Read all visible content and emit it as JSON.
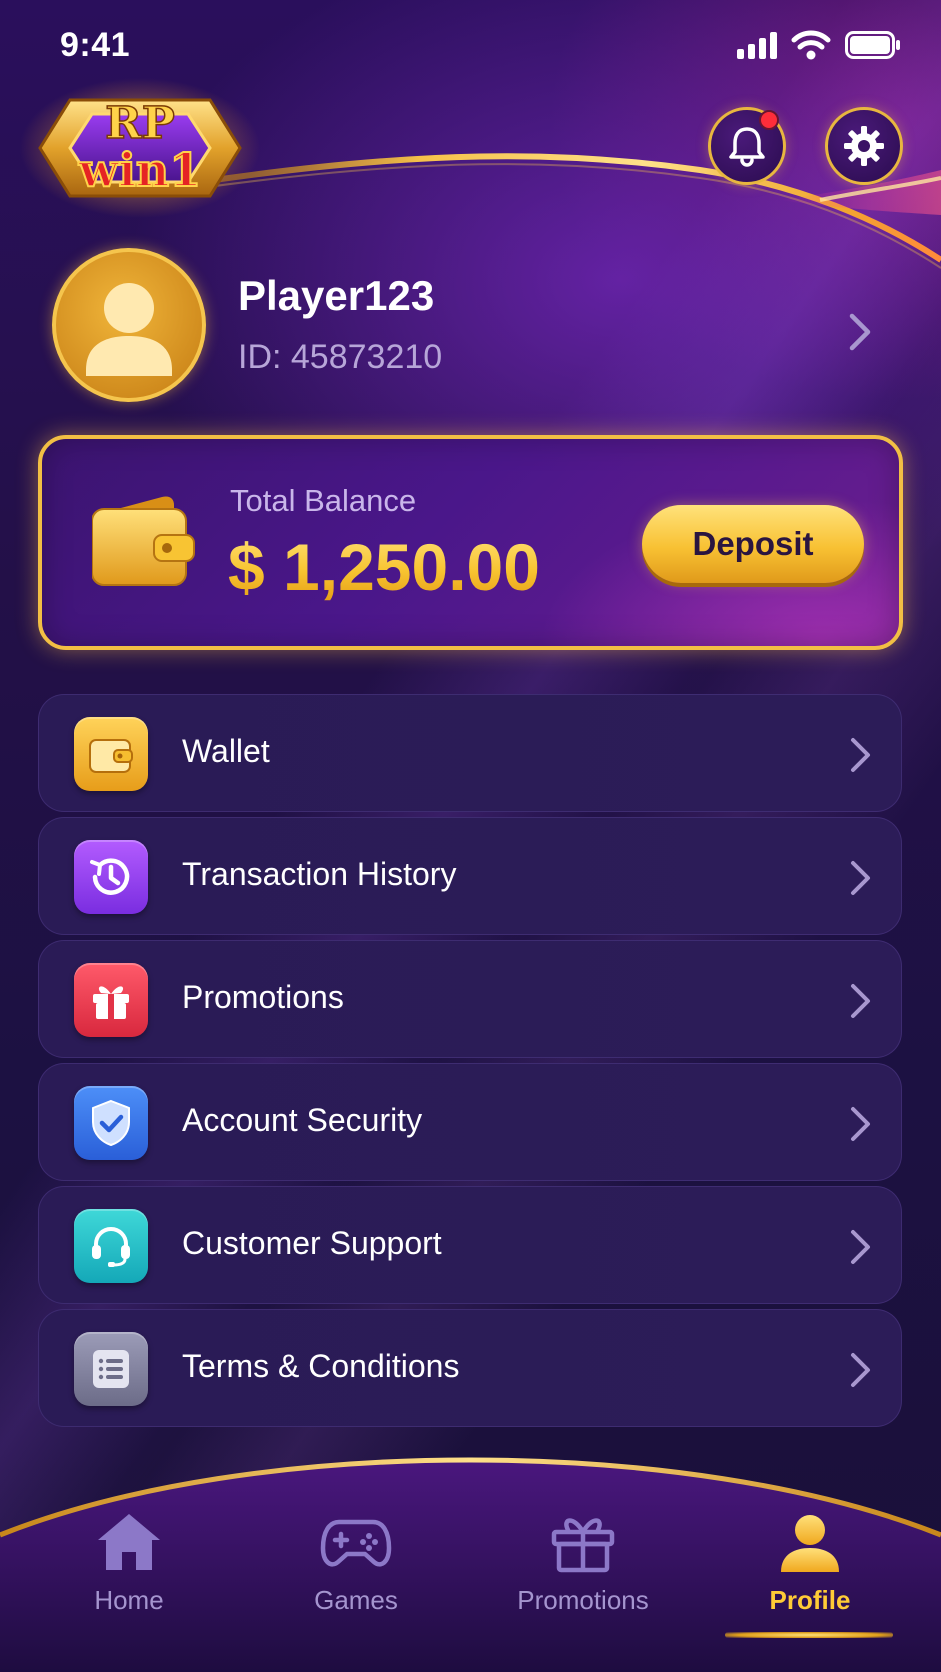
{
  "status_bar": {
    "time": "9:41"
  },
  "brand": {
    "logo_line1": "RP",
    "logo_line2": "win1"
  },
  "header": {
    "notifications_unread": true
  },
  "profile": {
    "name": "Player123",
    "id_text": "ID: 45873210"
  },
  "balance": {
    "label": "Total Balance",
    "amount": "$ 1,250.00",
    "deposit_label": "Deposit"
  },
  "menu": {
    "items": [
      {
        "label": "Wallet",
        "icon": "wallet-icon",
        "color": "#f2b52e"
      },
      {
        "label": "Transaction History",
        "icon": "history-icon",
        "color": "#9b45f0"
      },
      {
        "label": "Promotions",
        "icon": "gift-icon",
        "color": "#ef3f52"
      },
      {
        "label": "Account Security",
        "icon": "shield-icon",
        "color": "#3b7cf2"
      },
      {
        "label": "Customer Support",
        "icon": "headset-icon",
        "color": "#22c1c8"
      },
      {
        "label": "Terms & Conditions",
        "icon": "document-icon",
        "color": "#8a8aa6"
      }
    ]
  },
  "bottom_nav": {
    "items": [
      {
        "label": "Home",
        "icon": "home-icon"
      },
      {
        "label": "Games",
        "icon": "gamepad-icon"
      },
      {
        "label": "Promotions",
        "icon": "gift-icon"
      },
      {
        "label": "Profile",
        "icon": "profile-icon",
        "active": true
      }
    ]
  },
  "colors": {
    "accent_gold": "#f2bf44",
    "background": "#1a0f3a",
    "active_nav": "#ffcb36"
  }
}
